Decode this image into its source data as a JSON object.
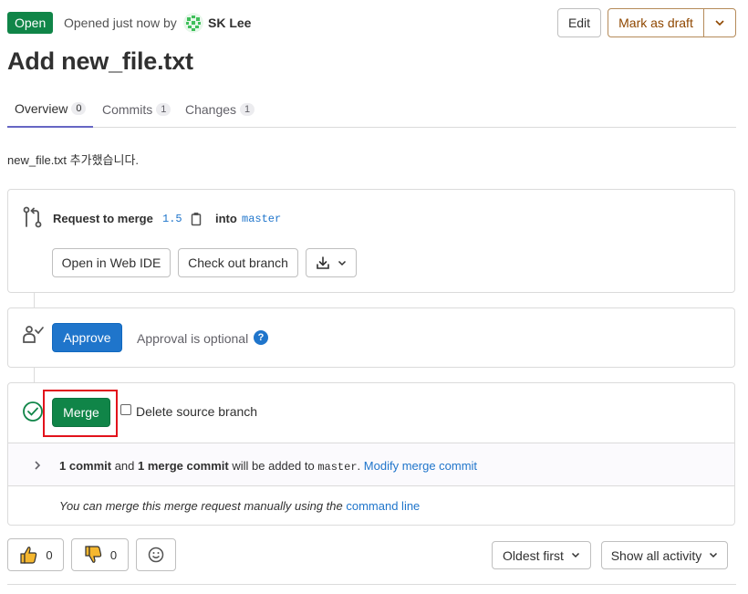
{
  "header": {
    "status_badge": "Open",
    "opened_text": "Opened just now by",
    "author": "SK Lee",
    "edit_label": "Edit",
    "draft_label": "Mark as draft"
  },
  "title": "Add new_file.txt",
  "tabs": [
    {
      "label": "Overview",
      "count": "0"
    },
    {
      "label": "Commits",
      "count": "1"
    },
    {
      "label": "Changes",
      "count": "1"
    }
  ],
  "description": "new_file.txt 추가했습니다.",
  "merge_request": {
    "request_label": "Request to merge",
    "source_branch": "1.5",
    "into_label": "into",
    "target_branch": "master",
    "open_ide_label": "Open in Web IDE",
    "checkout_label": "Check out branch"
  },
  "approval": {
    "approve_label": "Approve",
    "optional_text": "Approval is optional",
    "help_glyph": "?"
  },
  "merge": {
    "merge_label": "Merge",
    "delete_branch_label": "Delete source branch",
    "commit_count": "1 commit",
    "and_text": "and",
    "merge_commit_count": "1 merge commit",
    "added_text": "will be added to",
    "target_branch": "master",
    "modify_link": "Modify merge commit",
    "manual_text": "You can merge this merge request manually using the",
    "command_line_link": "command line"
  },
  "reactions": {
    "thumbsup_count": "0",
    "thumbsdown_count": "0"
  },
  "sort": {
    "order_label": "Oldest first",
    "filter_label": "Show all activity"
  },
  "colors": {
    "success": "#108548",
    "primary": "#1f75cb",
    "draft": "#8f4700",
    "highlight": "#e2121b"
  }
}
